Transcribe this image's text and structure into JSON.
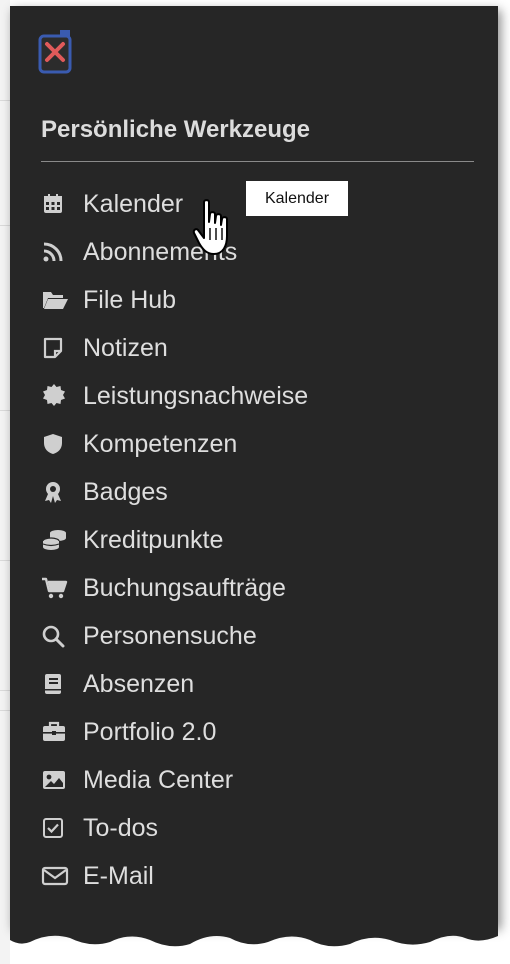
{
  "header": {
    "close_icon": "close-icon"
  },
  "section": {
    "title": "Persönliche Werkzeuge"
  },
  "menu": [
    {
      "label": "Kalender",
      "icon": "calendar-icon"
    },
    {
      "label": "Abonnements",
      "icon": "rss-icon"
    },
    {
      "label": "File Hub",
      "icon": "folder-open-icon"
    },
    {
      "label": "Notizen",
      "icon": "sticky-note-icon"
    },
    {
      "label": "Leistungsnachweise",
      "icon": "certificate-icon"
    },
    {
      "label": "Kompetenzen",
      "icon": "shield-icon"
    },
    {
      "label": "Badges",
      "icon": "award-icon"
    },
    {
      "label": "Kreditpunkte",
      "icon": "coins-icon"
    },
    {
      "label": "Buchungsaufträge",
      "icon": "cart-icon"
    },
    {
      "label": "Personensuche",
      "icon": "search-icon"
    },
    {
      "label": "Absenzen",
      "icon": "book-icon"
    },
    {
      "label": "Portfolio 2.0",
      "icon": "briefcase-icon"
    },
    {
      "label": "Media Center",
      "icon": "image-icon"
    },
    {
      "label": "To-dos",
      "icon": "checkbox-icon"
    },
    {
      "label": "E-Mail",
      "icon": "envelope-icon"
    }
  ],
  "tooltip": {
    "text": "Kalender"
  },
  "colors": {
    "panel": "#262626",
    "text": "#dedede",
    "close_accent": "#e05a5a",
    "close_border": "#3a5bb0"
  }
}
